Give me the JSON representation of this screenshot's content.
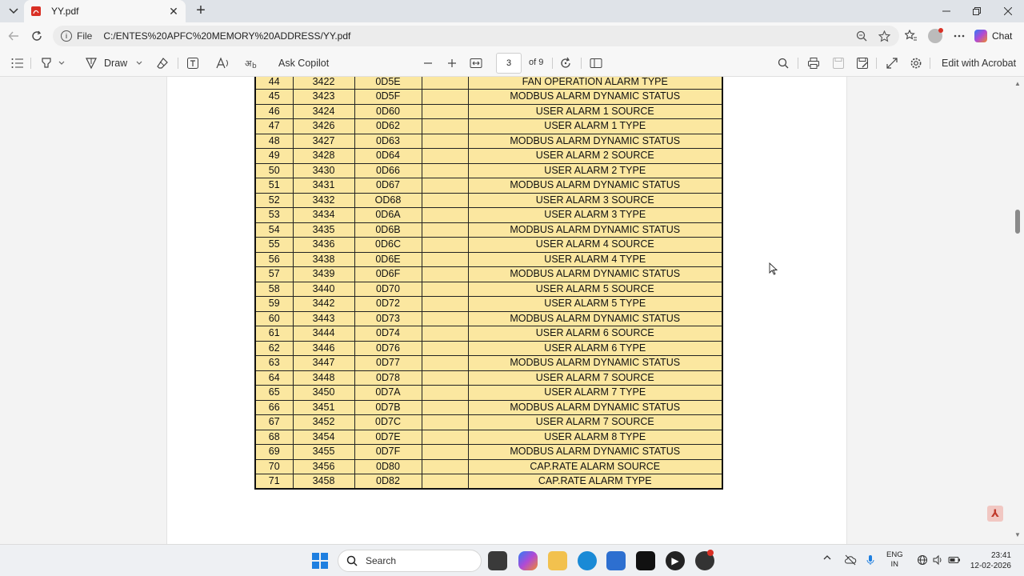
{
  "browser": {
    "tab_title": "YY.pdf",
    "address_scheme": "File",
    "address_url": "C:/ENTES%20APFC%20MEMORY%20ADDRESS/YY.pdf",
    "chat_label": "Chat"
  },
  "pdf_toolbar": {
    "draw_label": "Draw",
    "ask_copilot_label": "Ask Copilot",
    "page_number": "3",
    "page_of": "of 9",
    "edit_acrobat_label": "Edit with Acrobat"
  },
  "table": {
    "rows": [
      [
        "44",
        "3422",
        "0D5E",
        "",
        "FAN OPERATION ALARM TYPE"
      ],
      [
        "45",
        "3423",
        "0D5F",
        "",
        "MODBUS ALARM DYNAMIC STATUS"
      ],
      [
        "46",
        "3424",
        "0D60",
        "",
        "USER ALARM 1 SOURCE"
      ],
      [
        "47",
        "3426",
        "0D62",
        "",
        "USER ALARM 1 TYPE"
      ],
      [
        "48",
        "3427",
        "0D63",
        "",
        "MODBUS ALARM DYNAMIC STATUS"
      ],
      [
        "49",
        "3428",
        "0D64",
        "",
        "USER ALARM 2 SOURCE"
      ],
      [
        "50",
        "3430",
        "0D66",
        "",
        "USER ALARM 2 TYPE"
      ],
      [
        "51",
        "3431",
        "0D67",
        "",
        "MODBUS ALARM DYNAMIC STATUS"
      ],
      [
        "52",
        "3432",
        "OD68",
        "",
        "USER ALARM 3 SOURCE"
      ],
      [
        "53",
        "3434",
        "0D6A",
        "",
        "USER ALARM 3 TYPE"
      ],
      [
        "54",
        "3435",
        "0D6B",
        "",
        "MODBUS ALARM DYNAMIC STATUS"
      ],
      [
        "55",
        "3436",
        "0D6C",
        "",
        "USER ALARM 4 SOURCE"
      ],
      [
        "56",
        "3438",
        "0D6E",
        "",
        "USER ALARM 4 TYPE"
      ],
      [
        "57",
        "3439",
        "0D6F",
        "",
        "MODBUS ALARM DYNAMIC STATUS"
      ],
      [
        "58",
        "3440",
        "0D70",
        "",
        "USER ALARM 5 SOURCE"
      ],
      [
        "59",
        "3442",
        "0D72",
        "",
        "USER ALARM 5 TYPE"
      ],
      [
        "60",
        "3443",
        "0D73",
        "",
        "MODBUS ALARM DYNAMIC  STATUS"
      ],
      [
        "61",
        "3444",
        "0D74",
        "",
        "USER ALARM 6 SOURCE"
      ],
      [
        "62",
        "3446",
        "0D76",
        "",
        "USER ALARM 6 TYPE"
      ],
      [
        "63",
        "3447",
        "0D77",
        "",
        "MODBUS ALARM DYNAMIC  STATUS"
      ],
      [
        "64",
        "3448",
        "0D78",
        "",
        "USER ALARM 7 SOURCE"
      ],
      [
        "65",
        "3450",
        "0D7A",
        "",
        "USER ALARM 7 TYPE"
      ],
      [
        "66",
        "3451",
        "0D7B",
        "",
        "MODBUS ALARM DYNAMIC  STATUS"
      ],
      [
        "67",
        "3452",
        "0D7C",
        "",
        "USER ALARM 7 SOURCE"
      ],
      [
        "68",
        "3454",
        "0D7E",
        "",
        "USER ALARM 8 TYPE"
      ],
      [
        "69",
        "3455",
        "0D7F",
        "",
        "MODBUS ALARM DYNAMIC  STATUS"
      ],
      [
        "70",
        "3456",
        "0D80",
        "",
        "CAP.RATE ALARM SOURCE"
      ],
      [
        "71",
        "3458",
        "0D82",
        "",
        "CAP.RATE ALARM TYPE"
      ]
    ]
  },
  "taskbar": {
    "search_placeholder": "Search",
    "lang_line1": "ENG",
    "lang_line2": "IN",
    "time": "23:41",
    "date": "12-02-2026"
  },
  "colors": {
    "table_fill": "#fbe7a0",
    "accent": "#1e7fe0"
  }
}
